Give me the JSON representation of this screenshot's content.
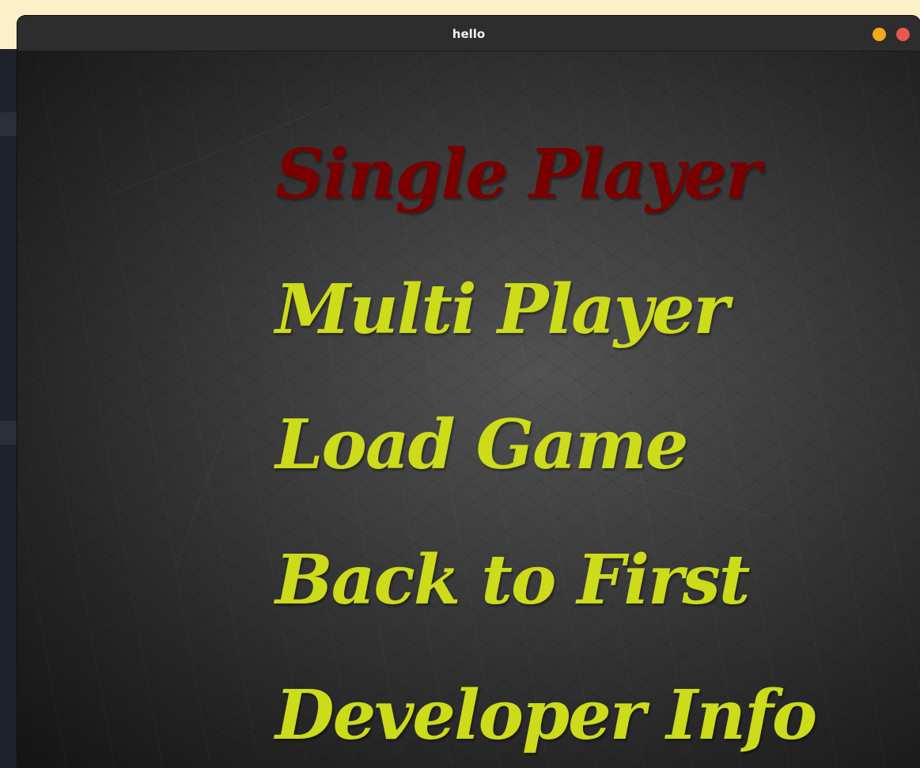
{
  "window": {
    "title": "hello"
  },
  "menu": {
    "items": [
      {
        "label": "Single Player",
        "selected": true
      },
      {
        "label": "Multi Player",
        "selected": false
      },
      {
        "label": "Load Game",
        "selected": false
      },
      {
        "label": "Back to First",
        "selected": false
      },
      {
        "label": "Developer Info",
        "selected": false
      }
    ]
  },
  "colors": {
    "selected_item": "#7a0000",
    "menu_item": "#ccdb1a",
    "minimize_button": "#f2a91c",
    "close_button": "#e9574d",
    "titlebar": "#2d2d2d"
  }
}
